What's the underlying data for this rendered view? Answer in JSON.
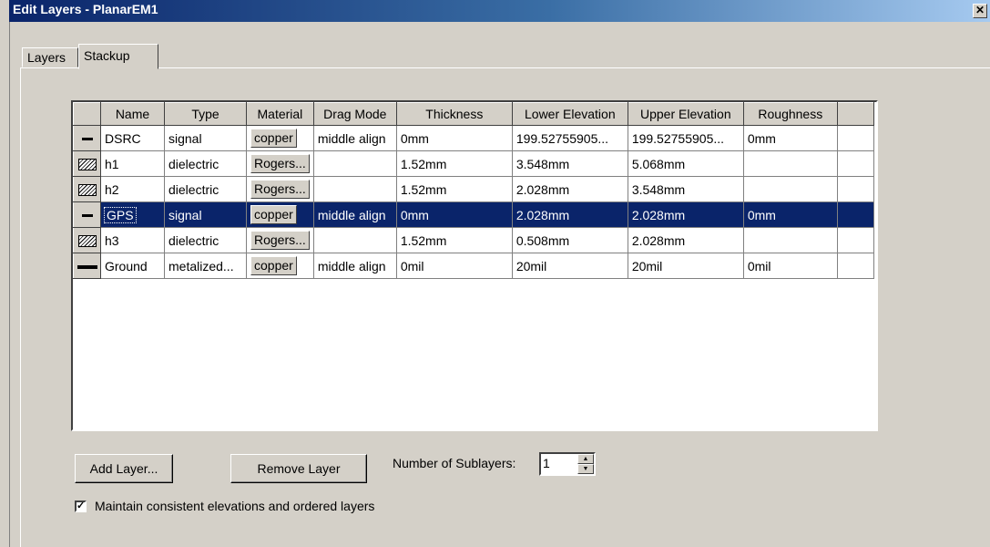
{
  "window": {
    "title": "Edit Layers - PlanarEM1",
    "close_glyph": "✕"
  },
  "tabs": [
    {
      "label": "Layers",
      "active": false
    },
    {
      "label": "Stackup",
      "active": true
    }
  ],
  "grid": {
    "columns": [
      "",
      "Name",
      "Type",
      "Material",
      "Drag Mode",
      "Thickness",
      "Lower Elevation",
      "Upper Elevation",
      "Roughness",
      ""
    ],
    "rows": [
      {
        "icon": "signal-layer-icon",
        "name": "DSRC",
        "type": "signal",
        "material": "copper",
        "drag_mode": "middle align",
        "thickness": "0mm",
        "lower": "199.52755905...",
        "upper": "199.52755905...",
        "roughness": "0mm",
        "selected": false
      },
      {
        "icon": "dielectric-layer-icon",
        "name": "h1",
        "type": "dielectric",
        "material": "Rogers...",
        "drag_mode": "",
        "thickness": "1.52mm",
        "lower": "3.548mm",
        "upper": "5.068mm",
        "roughness": "",
        "selected": false
      },
      {
        "icon": "dielectric-layer-icon",
        "name": "h2",
        "type": "dielectric",
        "material": "Rogers...",
        "drag_mode": "",
        "thickness": "1.52mm",
        "lower": "2.028mm",
        "upper": "3.548mm",
        "roughness": "",
        "selected": false
      },
      {
        "icon": "signal-layer-icon",
        "name": "GPS",
        "type": "signal",
        "material": "copper",
        "drag_mode": "middle align",
        "thickness": "0mm",
        "lower": "2.028mm",
        "upper": "2.028mm",
        "roughness": "0mm",
        "selected": true
      },
      {
        "icon": "dielectric-layer-icon",
        "name": "h3",
        "type": "dielectric",
        "material": "Rogers...",
        "drag_mode": "",
        "thickness": "1.52mm",
        "lower": "0.508mm",
        "upper": "2.028mm",
        "roughness": "",
        "selected": false
      },
      {
        "icon": "metalized-layer-icon",
        "name": "Ground",
        "type": "metalized...",
        "material": "copper",
        "drag_mode": "middle align",
        "thickness": "0mil",
        "lower": "20mil",
        "upper": "20mil",
        "roughness": "0mil",
        "selected": false
      }
    ]
  },
  "controls": {
    "add_layer_label": "Add Layer...",
    "remove_layer_label": "Remove Layer",
    "sublayers_label": "Number of Sublayers:",
    "sublayers_value": "1",
    "maintain_label": "Maintain consistent elevations and ordered layers",
    "maintain_checked": true
  },
  "colors": {
    "selection": "#0a246a",
    "face": "#d4d0c8"
  }
}
